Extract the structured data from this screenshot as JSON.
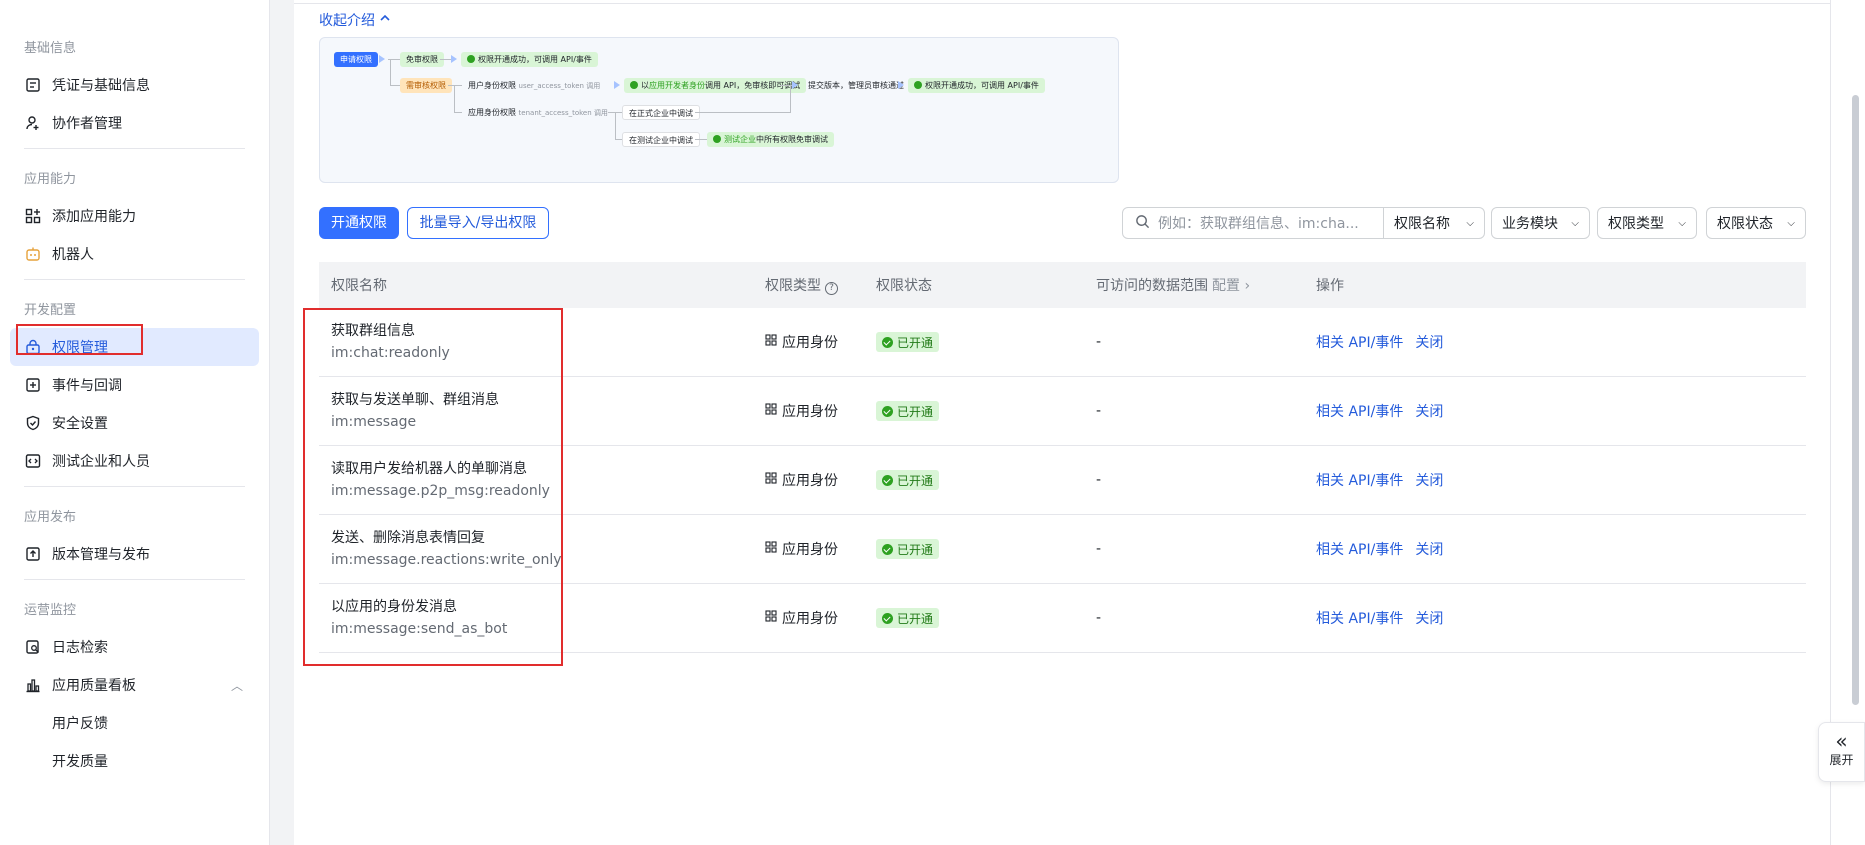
{
  "sidebar": {
    "sections": [
      {
        "title": "基础信息",
        "items": [
          {
            "label": "凭证与基础信息",
            "icon": "credential-icon"
          },
          {
            "label": "协作者管理",
            "icon": "user-add-icon"
          }
        ]
      },
      {
        "title": "应用能力",
        "items": [
          {
            "label": "添加应用能力",
            "icon": "apps-add-icon"
          },
          {
            "label": "机器人",
            "icon": "robot-icon"
          }
        ]
      },
      {
        "title": "开发配置",
        "items": [
          {
            "label": "权限管理",
            "icon": "lock-icon"
          },
          {
            "label": "事件与回调",
            "icon": "event-icon"
          },
          {
            "label": "安全设置",
            "icon": "shield-icon"
          },
          {
            "label": "测试企业和人员",
            "icon": "code-icon"
          }
        ]
      },
      {
        "title": "应用发布",
        "items": [
          {
            "label": "版本管理与发布",
            "icon": "upload-icon"
          }
        ]
      },
      {
        "title": "运营监控",
        "items": [
          {
            "label": "日志检索",
            "icon": "log-search-icon"
          },
          {
            "label": "应用质量看板",
            "icon": "bar-chart-icon"
          },
          {
            "label": "用户反馈"
          },
          {
            "label": "开发质量"
          }
        ]
      }
    ]
  },
  "intro": {
    "collapse_label": "收起介绍",
    "flow": {
      "apply": "申请权限",
      "free": "免审权限",
      "free_result": "权限开通成功，可调用 API/事件",
      "review": "需审核权限",
      "user_identity": "用户身份权限",
      "user_token": "user_access_token 调用",
      "dev_identity_pre": "以",
      "dev_identity_hl": "应用开发者身份",
      "dev_identity_post": "调用 API，免审核即可调试",
      "submit": "提交版本，管理员审核通过",
      "final_result": "权限开通成功，可调用 API/事件",
      "app_identity": "应用身份权限",
      "tenant_token": "tenant_access_token 调用",
      "formal_debug": "在正式企业中调试",
      "test_debug": "在测试企业中调试",
      "test_result_hl": "测试企业",
      "test_result_post": "中所有权限免审调试"
    }
  },
  "toolbar": {
    "primary_label": "开通权限",
    "secondary_label": "批量导入/导出权限",
    "search_placeholder": "例如：获取群组信息、im:cha...",
    "filters": [
      "权限名称",
      "业务模块",
      "权限类型",
      "权限状态"
    ]
  },
  "table": {
    "headers": {
      "name": "权限名称",
      "type": "权限类型",
      "status": "权限状态",
      "scope": "可访问的数据范围",
      "scope_cfg": "配置",
      "ops": "操作"
    },
    "rows": [
      {
        "name": "获取群组信息",
        "code": "im:chat:readonly",
        "type": "应用身份",
        "status": "已开通",
        "scope": "-",
        "op1": "相关 API/事件",
        "op2": "关闭"
      },
      {
        "name": "获取与发送单聊、群组消息",
        "code": "im:message",
        "type": "应用身份",
        "status": "已开通",
        "scope": "-",
        "op1": "相关 API/事件",
        "op2": "关闭"
      },
      {
        "name": "读取用户发给机器人的单聊消息",
        "code": "im:message.p2p_msg:readonly",
        "type": "应用身份",
        "status": "已开通",
        "scope": "-",
        "op1": "相关 API/事件",
        "op2": "关闭"
      },
      {
        "name": "发送、删除消息表情回复",
        "code": "im:message.reactions:write_only",
        "type": "应用身份",
        "status": "已开通",
        "scope": "-",
        "op1": "相关 API/事件",
        "op2": "关闭"
      },
      {
        "name": "以应用的身份发消息",
        "code": "im:message:send_as_bot",
        "type": "应用身份",
        "status": "已开通",
        "scope": "-",
        "op1": "相关 API/事件",
        "op2": "关闭"
      }
    ]
  },
  "expand_label": "展开",
  "colors": {
    "accent": "#3370ff",
    "active_bg": "#e1eaff",
    "success": "#2ea121",
    "highlight": "#e12d2d"
  }
}
